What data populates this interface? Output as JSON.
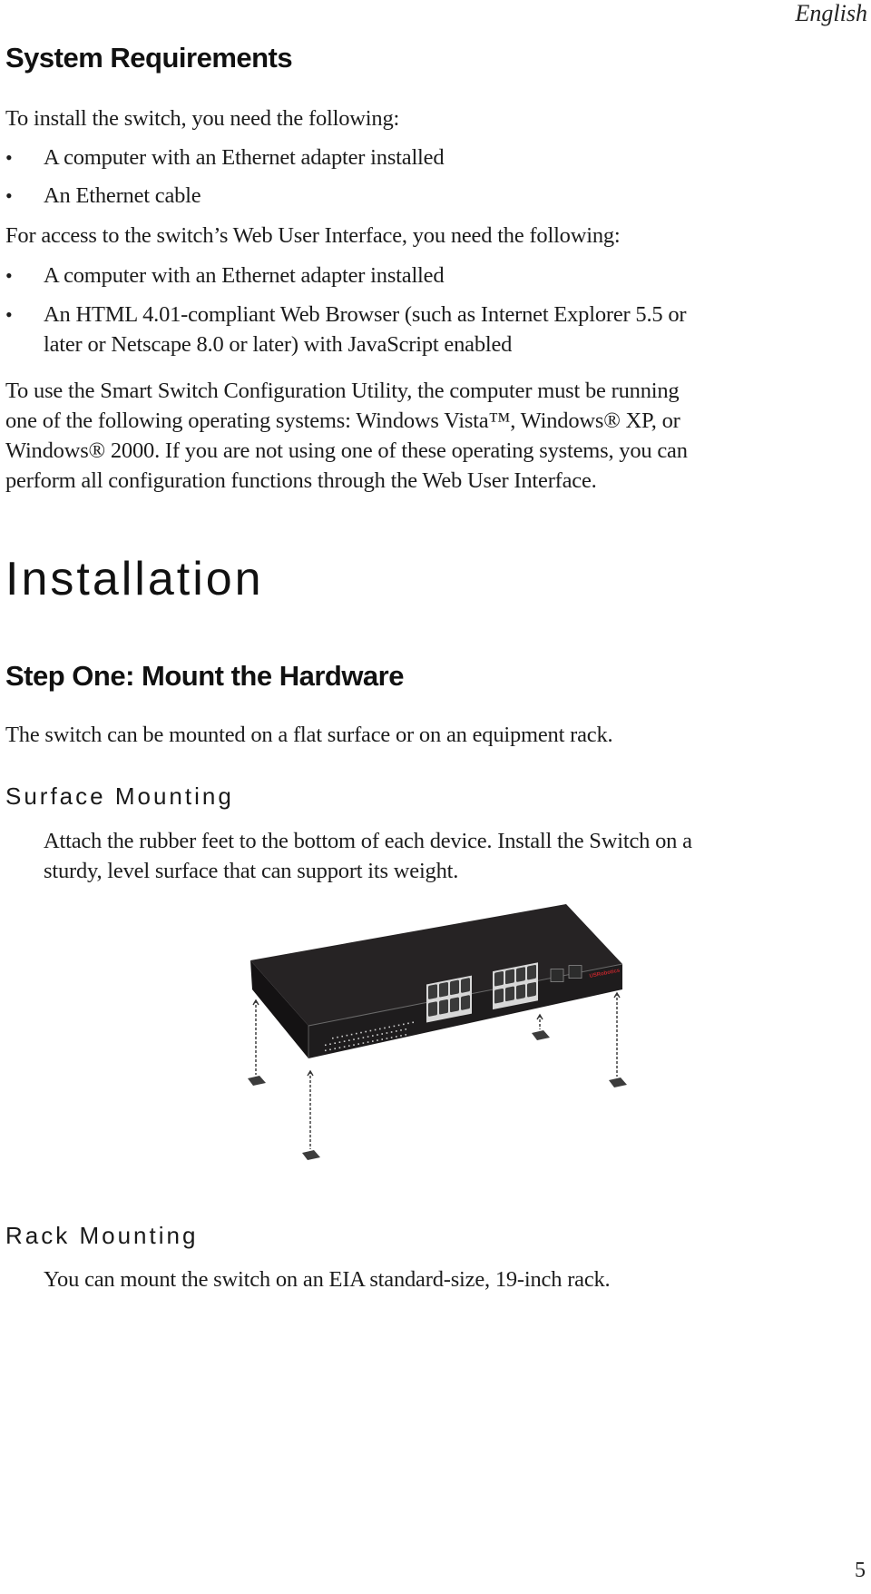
{
  "header": {
    "language": "English"
  },
  "system_requirements": {
    "heading": "System Requirements",
    "install_intro": "To install the switch, you need the following:",
    "install_items": [
      "A computer with an Ethernet adapter installed",
      "An Ethernet cable"
    ],
    "web_intro": "For access to the switch’s Web User Interface, you need the following:",
    "web_items": [
      {
        "line1": "A computer with an Ethernet adapter installed",
        "line2": ""
      },
      {
        "line1": "An HTML 4.01-compliant Web Browser (such as Internet Explorer 5.5 or",
        "line2": "later or Netscape 8.0 or later) with JavaScript enabled"
      }
    ],
    "utility_paragraph": [
      "To use the Smart Switch Configuration Utility, the computer must be running",
      "one of the following operating systems: Windows Vista™, Windows® XP, or",
      "Windows® 2000. If you are not using one of these operating systems, you can",
      "perform all configuration functions through the Web User Interface."
    ]
  },
  "installation": {
    "heading": "Installation",
    "step_one": {
      "heading": "Step One: Mount the Hardware",
      "intro": "The switch can be mounted on a flat surface or on an equipment rack."
    },
    "surface_mounting": {
      "heading": "Surface Mounting",
      "lines": [
        "Attach the rubber feet to the bottom of each device. Install the Switch on a",
        "sturdy, level surface that can support its weight."
      ],
      "figure": {
        "subject": "switch-with-rubber-feet-illustration",
        "brand_label": "USRobotics",
        "ports_rj45": 16,
        "ports_sfp": 2,
        "rubber_feet": 4,
        "colors": {
          "chassis": "#1e1c1d",
          "chassis_top": "#262324",
          "port": "#3a3a3a",
          "port_frame": "#d8d8d8",
          "brand": "#c0262c",
          "feet": "#3c3c3c"
        }
      }
    },
    "rack_mounting": {
      "heading": "Rack Mounting",
      "text": "You can mount the switch on an EIA standard-size, 19-inch rack."
    }
  },
  "footer": {
    "page_number": "5"
  }
}
